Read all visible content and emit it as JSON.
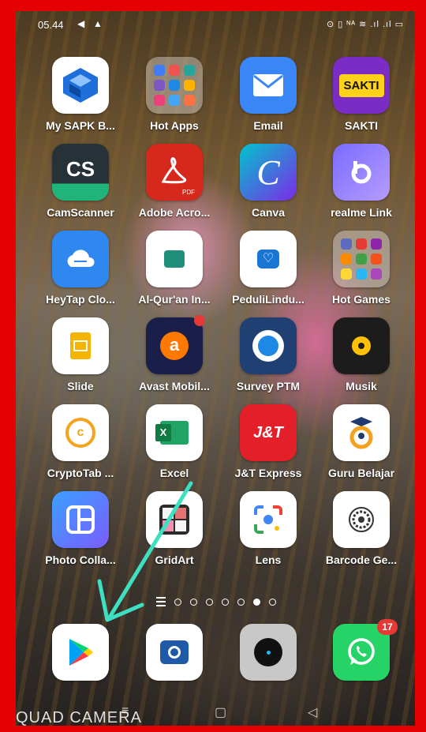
{
  "status_bar": {
    "time": "05.44",
    "indicators": "⊙ ▯ ᴺᴬ ≋ .ıl .ıl ▭"
  },
  "apps": [
    {
      "label": "My SAPK B...",
      "icon": "sapk-icon"
    },
    {
      "label": "Hot Apps",
      "icon": "folder-icon"
    },
    {
      "label": "Email",
      "icon": "email-icon"
    },
    {
      "label": "SAKTI",
      "icon": "sakti-icon",
      "icon_text": "SAKTI"
    },
    {
      "label": "CamScanner",
      "icon": "camscanner-icon",
      "icon_text": "CS"
    },
    {
      "label": "Adobe Acro...",
      "icon": "adobe-acrobat-icon",
      "icon_text": "PDF"
    },
    {
      "label": "Canva",
      "icon": "canva-icon",
      "icon_text": "C"
    },
    {
      "label": "realme Link",
      "icon": "realme-link-icon"
    },
    {
      "label": "HeyTap Clo...",
      "icon": "cloud-icon"
    },
    {
      "label": "Al-Qur'an In...",
      "icon": "quran-icon"
    },
    {
      "label": "PeduliLindu...",
      "icon": "peduli-lindungi-icon"
    },
    {
      "label": "Hot Games",
      "icon": "folder-icon"
    },
    {
      "label": "Slide",
      "icon": "slide-icon"
    },
    {
      "label": "Avast Mobil...",
      "icon": "avast-icon"
    },
    {
      "label": "Survey PTM",
      "icon": "tut-wuri-icon"
    },
    {
      "label": "Musik",
      "icon": "music-icon"
    },
    {
      "label": "CryptoTab ...",
      "icon": "cryptotab-icon"
    },
    {
      "label": "Excel",
      "icon": "excel-icon",
      "icon_text": "X"
    },
    {
      "label": "J&T Express",
      "icon": "jt-express-icon",
      "icon_text": "J&T"
    },
    {
      "label": "Guru Belajar",
      "icon": "guru-belajar-icon"
    },
    {
      "label": "Photo Colla...",
      "icon": "photo-collage-icon"
    },
    {
      "label": "GridArt",
      "icon": "gridart-icon"
    },
    {
      "label": "Lens",
      "icon": "lens-icon"
    },
    {
      "label": "Barcode Ge...",
      "icon": "barcode-icon"
    }
  ],
  "dock": [
    {
      "icon": "play-store-icon"
    },
    {
      "icon": "camera-app-icon"
    },
    {
      "icon": "circle-app-icon"
    },
    {
      "icon": "whatsapp-icon",
      "badge": "17"
    }
  ],
  "watermark": "QUAD CAMERA",
  "colors": {
    "frame": "#e40000",
    "arrow": "#3de0c0"
  }
}
